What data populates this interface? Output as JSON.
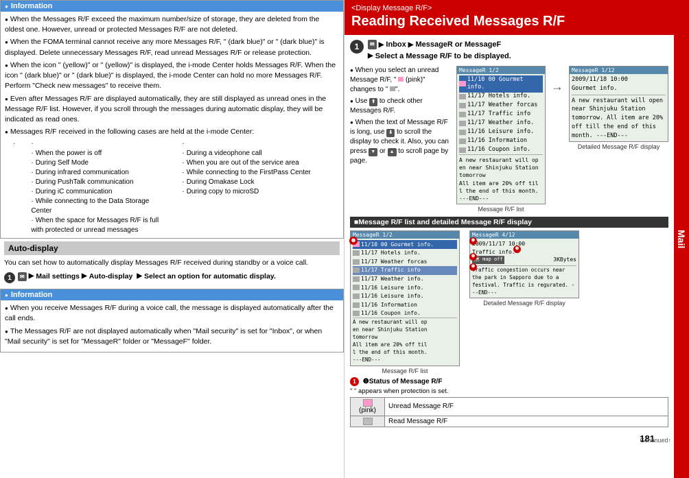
{
  "left": {
    "info_header": "Information",
    "info_items": [
      "When the Messages R/F exceed the maximum number/size of storage, they are deleted from the oldest one. However, unread or protected Messages R/F are not deleted.",
      "When the FOMA terminal cannot receive any more Messages R/F, \" (dark blue)\" or \" (dark blue)\" is displayed. Delete unnecessary Messages R/F, read unread Messages R/F or release protection.",
      "When the icon \" (yellow)\" or \" (yellow)\" is displayed, the i-mode Center holds Messages R/F. When the icon \" (dark blue)\" or \" (dark blue)\" is displayed, the i-mode Center can hold no more Messages R/F. Perform \"Check new messages\" to receive them.",
      "Even after Messages R/F are displayed automatically, they are still displayed as unread ones in the Message R/F list. However, if you scroll through the messages during automatic display, they will be indicated as read ones.",
      "Messages R/F received in the following cases are held at the i-mode Center:"
    ],
    "sub_list": [
      "When the power is off",
      "During Self Mode",
      "During infrared communication",
      "During PushTalk communication",
      "During iC communication",
      "While connecting to the Data Storage Center",
      "When the space for Messages R/F is full with protected or unread messages",
      "During a videophone call",
      "When you are out of the service area",
      "While connecting to the FirstPass Center",
      "During Omakase Lock",
      "During copy to microSD"
    ],
    "auto_display_title": "Auto-display",
    "auto_display_desc": "You can set how to automatically display Messages R/F received during standby or a voice call.",
    "step1_label": "1",
    "step1_parts": [
      "Mail settings",
      "Auto-display",
      "Select an option for automatic display."
    ],
    "info2_header": "Information",
    "info2_items": [
      "When you receive Messages R/F during a voice call, the message is displayed automatically after the call ends.",
      "The Messages R/F are not displayed automatically when \"Mail security\" is set for \"Inbox\", or when \"Mail security\" is set for \"MessageR\" folder or \"MessageF\" folder."
    ]
  },
  "right": {
    "header_subtitle": "<Display Message R/F>",
    "header_title": "Reading Received Messages R/F",
    "step1_label": "1",
    "step1_line1": "Inbox",
    "step1_line2": "MessageR or MessageF",
    "step1_line3": "Select a Message R/F to be displayed.",
    "bullets": [
      "When you select an unread Message R/F, \" (pink)\" changes to \" \".",
      "Use  to check other Messages R/F.",
      "When the text of Message R/F is long, use  to scroll the display to check it. Also, you can press  /  (  /  ) or  /  to scroll page by page."
    ],
    "check_other": "check other",
    "screen1_title": "MessageR   1/2",
    "screen1_rows": [
      {
        "icon": "pink",
        "text": "11/10 00 Gourmet info."
      },
      {
        "icon": "gray",
        "text": "11/17 Hotels info."
      },
      {
        "icon": "gray",
        "text": "11/17 Weather forcas"
      },
      {
        "icon": "gray",
        "text": "11/17 Traffic info"
      },
      {
        "icon": "gray",
        "text": "11/17 Weather info."
      },
      {
        "icon": "gray",
        "text": "11/16 Leisure info."
      },
      {
        "icon": "gray",
        "text": "11/16 Information"
      },
      {
        "icon": "gray",
        "text": "11/16 Coupon info."
      }
    ],
    "screen1_label": "Message R/F list",
    "screen2_title": "MessageR   1/12",
    "screen2_date": "2009/11/18 10:00",
    "screen2_sender": "Gourmet info.",
    "screen2_body": "A new restaurant will open near Shinjuku Station tomorrow. All item are 20% off till the end of this month. ---END---",
    "screen2_label": "Detailed Message R/F display",
    "section_title": "■Message R/F list and detailed Message R/F display",
    "big_screen1_title": "MessageR   1/2",
    "big_screen1_rows": [
      {
        "icon": "pink",
        "highlight": true,
        "text": "11/10 00 Gourmet info."
      },
      {
        "icon": "gray",
        "text": "11/17 Hotels info."
      },
      {
        "icon": "gray",
        "text": "11/17 Weather forcas"
      },
      {
        "icon": "gray",
        "highlight_text": true,
        "text": "11/17 Traffic info"
      },
      {
        "icon": "gray",
        "text": "11/17 Weather info."
      },
      {
        "icon": "gray",
        "text": "11/16 Leisure info."
      },
      {
        "icon": "gray",
        "text": "11/16 Leisure info."
      },
      {
        "icon": "gray",
        "text": "11/16 Information"
      },
      {
        "icon": "gray",
        "text": "11/16 Coupon info."
      }
    ],
    "big_screen1_body": "A new restaurant will open near Shinjuku Station tomorrow. All item are 20% off till the end of this month. ---END---",
    "big_screen1_label": "Message R/F list",
    "big_screen2_title": "MessageR   4/12",
    "big_screen2_date": "2009/11/17 10:00",
    "big_screen2_sender": "Traffic info.",
    "big_screen2_size": "3KBytes",
    "big_screen2_icon": "map off",
    "big_screen2_body": "Traffic congestion occurs near the park in Sapporo due to a festival. Traffic is regurated. ---END---",
    "big_screen2_label": "Detailed Message R/F display",
    "status_title": "❶Status of Message R/F",
    "status_note": "\" \" appears when protection is set.",
    "status_rows": [
      {
        "icon": "(pink)",
        "label": "Unread Message R/F"
      },
      {
        "icon": "",
        "label": "Read Message R/F"
      }
    ],
    "page_num": "181",
    "continued": "Continued↑",
    "mail_tab": "Mail",
    "num_labels": [
      "❶",
      "❷",
      "❸",
      "❹",
      "❺"
    ]
  }
}
